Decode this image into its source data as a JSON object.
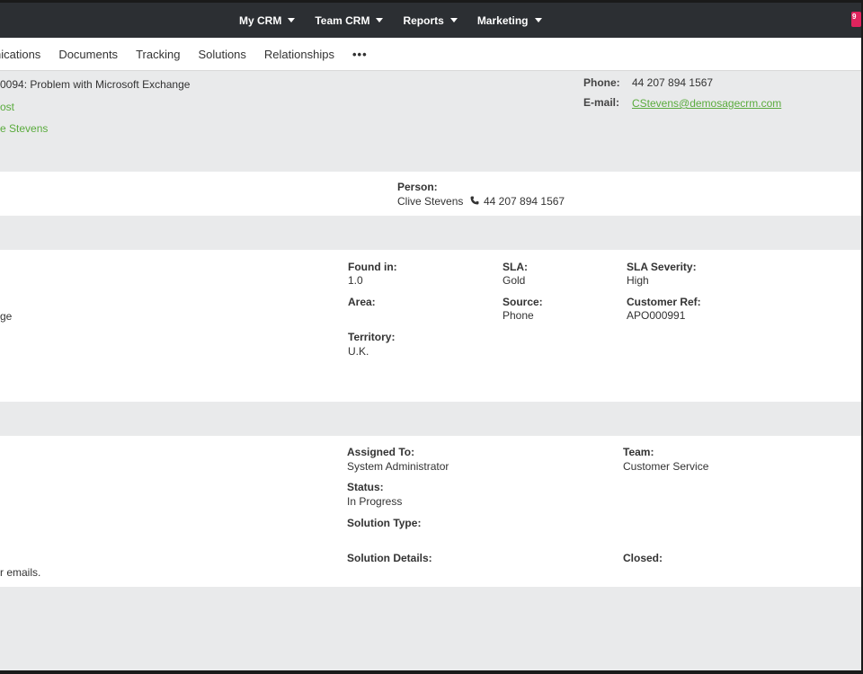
{
  "topnav": {
    "items": [
      {
        "label": "My CRM"
      },
      {
        "label": "Team CRM"
      },
      {
        "label": "Reports"
      },
      {
        "label": "Marketing"
      }
    ],
    "notification_count": "9"
  },
  "tabs": [
    "nications",
    "Documents",
    "Tracking",
    "Solutions",
    "Relationships",
    "•••"
  ],
  "summary": {
    "case_title": "0094: Problem with Microsoft Exchange",
    "line2": "ost",
    "line3": "e Stevens",
    "phone_label": "Phone:",
    "phone_value": "44 207 894 1567",
    "email_label": "E-mail:",
    "email_value": "CStevens@demosagecrm.com"
  },
  "person": {
    "label": "Person:",
    "name": "Clive Stevens",
    "phone": "44 207 894 1567"
  },
  "details": {
    "left_fragment": "ge",
    "found_in_label": "Found in:",
    "found_in_value": "1.0",
    "sla_label": "SLA:",
    "sla_value": "Gold",
    "sla_severity_label": "SLA Severity:",
    "sla_severity_value": "High",
    "area_label": "Area:",
    "area_value": "",
    "source_label": "Source:",
    "source_value": "Phone",
    "customer_ref_label": "Customer Ref:",
    "customer_ref_value": "APO000991",
    "territory_label": "Territory:",
    "territory_value": "U.K."
  },
  "status": {
    "assigned_to_label": "Assigned To:",
    "assigned_to_value": "System Administrator",
    "team_label": "Team:",
    "team_value": "Customer Service",
    "status_label": "Status:",
    "status_value": "In Progress",
    "solution_type_label": "Solution Type:",
    "solution_type_value": "",
    "solution_details_label": "Solution Details:",
    "closed_label": "Closed:",
    "left_fragment": "r emails."
  },
  "colors": {
    "nav_bg": "#2c2f33",
    "link_green": "#5aab3d",
    "panel_gray": "#e9eaeb"
  }
}
